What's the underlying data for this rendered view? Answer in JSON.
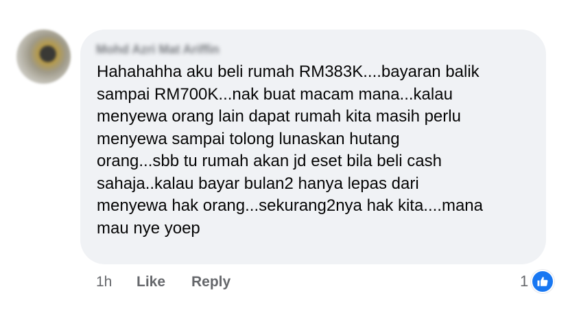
{
  "comment": {
    "author": "Mohd Azri Mat Ariffin",
    "text": "Hahahahha aku beli rumah RM383K....bayaran balik\nsampai RM700K...nak buat macam mana...kalau\nmenyewa orang lain dapat rumah kita masih perlu\nmenyewa sampai tolong lunaskan hutang\norang...sbb tu rumah akan jd eset bila beli cash\nsahaja..kalau bayar bulan2 hanya lepas dari\nmenyewa hak orang...sekurang2nya hak kita....mana\nmau nye yoep",
    "timestamp": "1h",
    "like_label": "Like",
    "reply_label": "Reply",
    "reaction_count": "1",
    "reaction_icon": "thumbs-up-icon"
  },
  "colors": {
    "bubble": "#f0f2f5",
    "text": "#050505",
    "secondary": "#65676b",
    "like_blue": "#1877f2"
  }
}
